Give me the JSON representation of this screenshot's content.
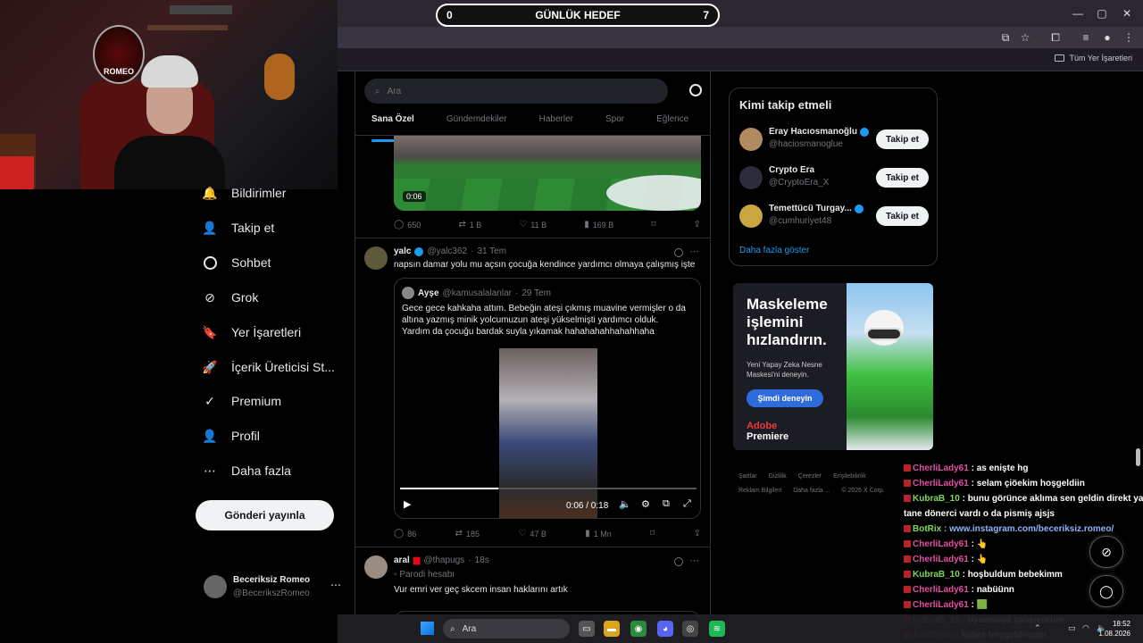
{
  "goal": {
    "left_value": "0",
    "title": "GÜNLÜK HEDEF",
    "right_value": "7"
  },
  "webcam": {
    "logo_text": "ROMEO"
  },
  "browser": {
    "bookmarks_folder": "Tüm Yer İşaretleri"
  },
  "nav": {
    "items": [
      {
        "label": "Bildirimler",
        "icon": "bell-icon"
      },
      {
        "label": "Takip et",
        "icon": "follow-icon"
      },
      {
        "label": "Sohbet",
        "icon": "chat-icon"
      },
      {
        "label": "Grok",
        "icon": "grok-icon"
      },
      {
        "label": "Yer İşaretleri",
        "icon": "bookmark-icon"
      },
      {
        "label": "İçerik Üreticisi St...",
        "icon": "rocket-icon"
      },
      {
        "label": "Premium",
        "icon": "premium-icon"
      },
      {
        "label": "Profil",
        "icon": "profile-icon"
      },
      {
        "label": "Daha fazla",
        "icon": "more-icon"
      }
    ],
    "post_button": "Gönderi yayınla",
    "account": {
      "name": "Beceriksiz Romeo",
      "handle": "@BecerikszRomeo"
    }
  },
  "timeline": {
    "search_placeholder": "Ara",
    "tabs": [
      "Sana Özel",
      "Gündemdekiler",
      "Haberler",
      "Spor",
      "Eğlence"
    ],
    "tweet0": {
      "video_duration": "0:06",
      "replies": "650",
      "reposts": "1 B",
      "likes": "11 B",
      "views": "169 B"
    },
    "tweet1": {
      "name": "yalc",
      "handle": "@yalc362",
      "time": "31 Tem",
      "text": "napsın damar yolu mu açsın çocuğa kendince yardımcı olmaya çalışmış işte",
      "quote": {
        "name": "Ayşe",
        "handle": "@kamusalalanlar",
        "time": "29 Tem",
        "line1": "Gece gece kahkaha attım. Bebeğin ateşi çıkmış muavine vermişler o da",
        "line2": "altına yazmış minik yolcumuzun ateşi yükselmişti yardımcı olduk.",
        "line3": "Yardım da çocuğu bardak suyla yıkamak hahahahahhahahhaha",
        "video_time": "0:06 / 0:18",
        "video_progress": 0.33
      },
      "replies": "86",
      "reposts": "185",
      "likes": "47 B",
      "views": "1 Mn"
    },
    "tweet2": {
      "name": "aral",
      "handle": "@thapugs",
      "time": "18s",
      "parody_label": "Parodi hesabı",
      "text": "Vur emri ver geç skcem insan haklarını artık"
    }
  },
  "who_to_follow": {
    "title": "Kimi takip etmeli",
    "accounts": [
      {
        "name": "Eray Hacıosmanoğlu",
        "handle": "@haciosmanoglue",
        "verified": true,
        "button": "Takip et"
      },
      {
        "name": "Crypto Era",
        "handle": "@CryptoEra_X",
        "verified": false,
        "button": "Takip et"
      },
      {
        "name": "Temettücü Turgay...",
        "handle": "@cumhuriyet48",
        "verified": true,
        "button": "Takip et"
      }
    ],
    "show_more": "Daha fazla göster"
  },
  "ad": {
    "title": "Maskeleme işlemini hızlandırın.",
    "subtitle": "Yeni Yapay Zeka Nesne Maskesi'ni deneyin.",
    "button": "Şimdi deneyin",
    "brand_top": "Adobe",
    "brand_bottom": "Premiere"
  },
  "footer": {
    "row1": [
      "Şartlar",
      "Gizlilik",
      "Çerezler",
      "Erişilebilirlik"
    ],
    "row2": [
      "Reklam Bilgileri",
      "Daha fazla ...",
      "© 2026 X Corp."
    ]
  },
  "chat": [
    {
      "user": "CherliLady61",
      "msg": ": as enişte hg",
      "color": "#e44fa4"
    },
    {
      "user": "CherliLady61",
      "msg": ": selam çiöekim hoşgeldiin",
      "color": "#e44fa4"
    },
    {
      "user": "KubraB_10",
      "msg": ": bunu görünce aklıma sen geldin direkt ya bi",
      "color": "#7ed957"
    },
    {
      "user": "",
      "msg": "tane dönerci vardı o da pismiş ajsjs",
      "color": "#ffffff"
    },
    {
      "user": "BotRix",
      "msg": ": www.instagram.com/beceriksiz.romeo/",
      "color": "#7ed957",
      "msg_color": "#8ab4f8"
    },
    {
      "user": "CherliLady61",
      "msg": ": 👆",
      "color": "#e44fa4"
    },
    {
      "user": "CherliLady61",
      "msg": ": 👆",
      "color": "#e44fa4"
    },
    {
      "user": "KubraB_10",
      "msg": ": hoşbuldum bebekimm",
      "color": "#7ed957"
    },
    {
      "user": "CherliLady61",
      "msg": ": nabüünn",
      "color": "#e44fa4"
    },
    {
      "user": "CherliLady61",
      "msg": ": 🟩",
      "color": "#e44fa4"
    },
    {
      "user": "KubraB_10",
      "msg": ": uyanmaya çalışıyorum",
      "color": "#7ed957"
    },
    {
      "user": "AzizBrain",
      "msg": ": kübra hoşgeldinnnn",
      "color": "#4aa3ff"
    }
  ],
  "taskbar": {
    "search_label": "Ara",
    "time": "18:52",
    "date": "1.08.2026"
  },
  "colors": {
    "accent": "#1d9bf0",
    "background": "#000000",
    "border": "#2f3336",
    "muted_text": "#71767b"
  }
}
